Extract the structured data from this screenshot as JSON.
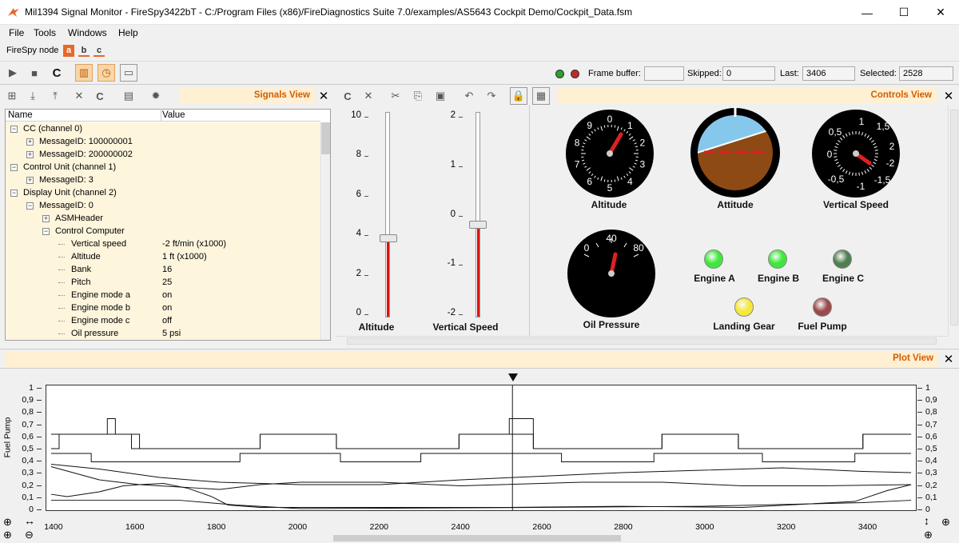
{
  "window": {
    "title": "Mil1394 Signal Monitor - FireSpy3422bT  -  C:/Program Files (x86)/FireDiagnostics Suite 7.0/examples/AS5643 Cockpit Demo/Cockpit_Data.fsm",
    "minimize": "—",
    "maximize": "☐",
    "close": "✕"
  },
  "menu": [
    "File",
    "Tools",
    "Windows",
    "Help"
  ],
  "node_bar": {
    "label": "FireSpy node",
    "nodes": [
      "a",
      "b",
      "c"
    ],
    "accent": "#e8672b"
  },
  "status": {
    "frame_buffer_label": "Frame buffer:",
    "frame_buffer_value": "",
    "skipped_label": "Skipped:",
    "skipped_value": "0",
    "last_label": "Last:",
    "last_value": "3406",
    "selected_label": "Selected:",
    "selected_value": "2528"
  },
  "signals_view": {
    "title": "Signals View",
    "col_name": "Name",
    "col_value": "Value",
    "rows": [
      {
        "name": "CC (channel 0)",
        "value": "",
        "exp": "−"
      },
      {
        "name": "MessageID: 100000001",
        "value": "",
        "exp": "+"
      },
      {
        "name": "MessageID: 200000002",
        "value": "",
        "exp": "+"
      },
      {
        "name": "Control Unit (channel 1)",
        "value": "",
        "exp": "−"
      },
      {
        "name": "MessageID: 3",
        "value": "",
        "exp": "+"
      },
      {
        "name": "Display Unit (channel 2)",
        "value": "",
        "exp": "−"
      },
      {
        "name": "MessageID: 0",
        "value": "",
        "exp": "−"
      },
      {
        "name": "ASMHeader",
        "value": "",
        "exp": "+"
      },
      {
        "name": "Control Computer",
        "value": "",
        "exp": "−"
      },
      {
        "name": "Vertical speed",
        "value": "-2 ft/min (x1000)",
        "exp": ""
      },
      {
        "name": "Altitude",
        "value": "1 ft (x1000)",
        "exp": ""
      },
      {
        "name": "Bank",
        "value": "16",
        "exp": ""
      },
      {
        "name": "Pitch",
        "value": "25",
        "exp": ""
      },
      {
        "name": "Engine mode a",
        "value": "on",
        "exp": ""
      },
      {
        "name": "Engine mode b",
        "value": "on",
        "exp": ""
      },
      {
        "name": "Engine mode c",
        "value": "off",
        "exp": ""
      },
      {
        "name": "Oil pressure",
        "value": "5 psi",
        "exp": ""
      }
    ]
  },
  "controls_view": {
    "title": "Controls View",
    "sliders": [
      {
        "label": "Altitude",
        "ticks": [
          "10",
          "8",
          "6",
          "4",
          "2",
          "0"
        ],
        "value": 3.8,
        "min": 0,
        "max": 10
      },
      {
        "label": "Vertical Speed",
        "ticks": [
          "2",
          "1",
          "0",
          "-1",
          "-2"
        ],
        "value": -0.2,
        "min": -2,
        "max": 2
      }
    ],
    "altimeter": {
      "label": "Altitude",
      "numbers": [
        "0",
        "1",
        "2",
        "3",
        "4",
        "5",
        "6",
        "7",
        "8",
        "9"
      ],
      "value": 1
    },
    "attitude": {
      "label": "Attitude"
    },
    "vsi": {
      "label": "Vertical Speed",
      "numbers": [
        "1",
        "1,5",
        "2",
        "-2",
        "-1,5",
        "-1",
        "-0,5",
        "0",
        "0,5"
      ]
    },
    "oil": {
      "label": "Oil Pressure",
      "numbers": [
        "0",
        "40",
        "80"
      ]
    },
    "leds": [
      {
        "label": "Engine A",
        "color": "#3ee83a"
      },
      {
        "label": "Engine B",
        "color": "#3ee83a"
      },
      {
        "label": "Engine C",
        "color": "#4f7f4f"
      },
      {
        "label": "Landing Gear",
        "color": "#f4e83a"
      },
      {
        "label": "Fuel Pump",
        "color": "#9a4a4a"
      }
    ]
  },
  "plot_view": {
    "title": "Plot View",
    "ylabel": "Fuel Pump",
    "yticks": [
      "1",
      "0,9",
      "0,8",
      "0,7",
      "0,6",
      "0,5",
      "0,4",
      "0,3",
      "0,2",
      "0,1",
      "0"
    ],
    "xticks": [
      "1400",
      "1600",
      "1800",
      "2000",
      "2200",
      "2400",
      "2600",
      "2800",
      "3000",
      "3200",
      "3400"
    ],
    "cursor_x": 2528
  },
  "chart_data": {
    "type": "line",
    "xlim": [
      1380,
      3520
    ],
    "ylim": [
      0,
      1
    ],
    "grid": false,
    "series": [
      {
        "x": [
          1380,
          1400,
          1400,
          1580,
          1580,
          1578,
          1600,
          1600,
          1780,
          1780,
          1900,
          1900,
          2090,
          2090,
          2395,
          2395,
          2580,
          2580,
          2900,
          2900,
          3090,
          3090,
          3400,
          3400,
          3520
        ],
        "y": [
          0.62,
          0.62,
          0.62,
          0.62,
          0.62,
          0.62,
          0.62,
          0.5,
          0.5,
          0.5,
          0.5,
          0.62,
          0.62,
          0.5,
          0.5,
          0.62,
          0.62,
          0.5,
          0.5,
          0.62,
          0.62,
          0.5,
          0.5,
          0.62,
          0.62
        ]
      },
      {
        "x": [
          1380,
          1400,
          1400,
          1520,
          1520,
          1540,
          1540,
          1580,
          1580,
          1900,
          1900,
          2090,
          2090,
          2395,
          2395,
          2520,
          2520,
          2580,
          2580,
          2900,
          2900,
          3090,
          3090,
          3400,
          3400,
          3520
        ],
        "y": [
          0.5,
          0.5,
          0.62,
          0.62,
          0.75,
          0.75,
          0.62,
          0.62,
          0.5,
          0.5,
          0.62,
          0.62,
          0.5,
          0.5,
          0.62,
          0.62,
          0.75,
          0.75,
          0.5,
          0.5,
          0.62,
          0.62,
          0.5,
          0.5,
          0.62,
          0.62
        ]
      },
      {
        "x": [
          1380,
          1480,
          1480,
          1850,
          1850,
          2100,
          2100,
          2300,
          2300,
          2650,
          2650,
          2880,
          2880,
          3150,
          3150,
          3380,
          3380,
          3520
        ],
        "y": [
          0.46,
          0.46,
          0.39,
          0.39,
          0.46,
          0.46,
          0.39,
          0.39,
          0.46,
          0.46,
          0.39,
          0.39,
          0.46,
          0.46,
          0.39,
          0.39,
          0.46,
          0.46
        ]
      },
      {
        "x": [
          1380,
          1500,
          1650,
          1800,
          2000,
          2200,
          2400,
          2600,
          2800,
          3000,
          3200,
          3400,
          3520
        ],
        "y": [
          0.37,
          0.33,
          0.26,
          0.22,
          0.2,
          0.2,
          0.24,
          0.27,
          0.3,
          0.32,
          0.34,
          0.31,
          0.3
        ]
      },
      {
        "x": [
          1380,
          1500,
          1600,
          1700,
          1800,
          1900,
          2000,
          2200,
          2400,
          2600,
          2700,
          2900,
          3100,
          3300,
          3520
        ],
        "y": [
          0.35,
          0.24,
          0.2,
          0.18,
          0.16,
          0.2,
          0.22,
          0.22,
          0.19,
          0.21,
          0.22,
          0.22,
          0.19,
          0.19,
          0.2
        ]
      },
      {
        "x": [
          1380,
          1420,
          1500,
          1560,
          1600,
          1660,
          1720,
          1780,
          1820,
          1900,
          2500,
          2800,
          3100,
          3380,
          3460,
          3520
        ],
        "y": [
          0.12,
          0.1,
          0.14,
          0.19,
          0.2,
          0.21,
          0.17,
          0.1,
          0.03,
          0.01,
          0.01,
          0.02,
          0.01,
          0.06,
          0.15,
          0.2
        ]
      },
      {
        "x": [
          1380,
          1700,
          1840,
          2000,
          2600,
          3000,
          3400,
          3520
        ],
        "y": [
          0.07,
          0.07,
          0.03,
          0.0,
          0.01,
          0.02,
          0.05,
          0.07
        ]
      }
    ]
  }
}
